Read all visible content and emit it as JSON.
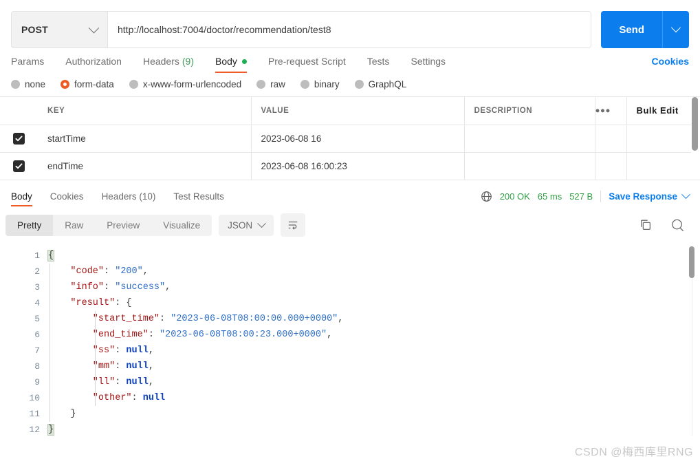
{
  "request": {
    "method": "POST",
    "url": "http://localhost:7004/doctor/recommendation/test8",
    "send_label": "Send",
    "tabs": [
      {
        "label": "Params",
        "active": false
      },
      {
        "label": "Authorization",
        "active": false
      },
      {
        "label": "Headers",
        "count": "(9)",
        "active": false
      },
      {
        "label": "Body",
        "active": true,
        "dot": true
      },
      {
        "label": "Pre-request Script",
        "active": false
      },
      {
        "label": "Tests",
        "active": false
      },
      {
        "label": "Settings",
        "active": false
      }
    ],
    "cookies_label": "Cookies",
    "body_types": [
      {
        "label": "none",
        "checked": false
      },
      {
        "label": "form-data",
        "checked": true
      },
      {
        "label": "x-www-form-urlencoded",
        "checked": false
      },
      {
        "label": "raw",
        "checked": false
      },
      {
        "label": "binary",
        "checked": false
      },
      {
        "label": "GraphQL",
        "checked": false
      }
    ],
    "table": {
      "headers": {
        "key": "KEY",
        "value": "VALUE",
        "description": "DESCRIPTION"
      },
      "dots_label": "●●●",
      "bulk_edit_label": "Bulk Edit",
      "rows": [
        {
          "checked": true,
          "key": "startTime",
          "value": "2023-06-08 16",
          "description": ""
        },
        {
          "checked": true,
          "key": "endTime",
          "value": "2023-06-08 16:00:23",
          "description": ""
        }
      ]
    }
  },
  "response": {
    "tabs": [
      {
        "label": "Body",
        "active": true
      },
      {
        "label": "Cookies",
        "active": false
      },
      {
        "label": "Headers (10)",
        "active": false
      },
      {
        "label": "Test Results",
        "active": false
      }
    ],
    "status": "200 OK",
    "time": "65 ms",
    "size": "527 B",
    "save_response_label": "Save Response",
    "view_modes": [
      {
        "label": "Pretty",
        "active": true
      },
      {
        "label": "Raw",
        "active": false
      },
      {
        "label": "Preview",
        "active": false
      },
      {
        "label": "Visualize",
        "active": false
      }
    ],
    "format": "JSON",
    "code_lines": [
      {
        "n": "1",
        "indent": 0,
        "tokens": [
          {
            "t": "{",
            "c": "p brace-hl"
          }
        ]
      },
      {
        "n": "2",
        "indent": 1,
        "tokens": [
          {
            "t": "    \"code\"",
            "c": "k"
          },
          {
            "t": ": ",
            "c": "p"
          },
          {
            "t": "\"200\"",
            "c": "s"
          },
          {
            "t": ",",
            "c": "p"
          }
        ]
      },
      {
        "n": "3",
        "indent": 1,
        "tokens": [
          {
            "t": "    \"info\"",
            "c": "k"
          },
          {
            "t": ": ",
            "c": "p"
          },
          {
            "t": "\"success\"",
            "c": "s"
          },
          {
            "t": ",",
            "c": "p"
          }
        ]
      },
      {
        "n": "4",
        "indent": 1,
        "tokens": [
          {
            "t": "    \"result\"",
            "c": "k"
          },
          {
            "t": ": ",
            "c": "p"
          },
          {
            "t": "{",
            "c": "p"
          }
        ]
      },
      {
        "n": "5",
        "indent": 2,
        "tokens": [
          {
            "t": "        \"start_time\"",
            "c": "k"
          },
          {
            "t": ": ",
            "c": "p"
          },
          {
            "t": "\"2023-06-08T08:00:00.000+0000\"",
            "c": "s"
          },
          {
            "t": ",",
            "c": "p"
          }
        ]
      },
      {
        "n": "6",
        "indent": 2,
        "tokens": [
          {
            "t": "        \"end_time\"",
            "c": "k"
          },
          {
            "t": ": ",
            "c": "p"
          },
          {
            "t": "\"2023-06-08T08:00:23.000+0000\"",
            "c": "s"
          },
          {
            "t": ",",
            "c": "p"
          }
        ]
      },
      {
        "n": "7",
        "indent": 2,
        "tokens": [
          {
            "t": "        \"ss\"",
            "c": "k"
          },
          {
            "t": ": ",
            "c": "p"
          },
          {
            "t": "null",
            "c": "nl"
          },
          {
            "t": ",",
            "c": "p"
          }
        ]
      },
      {
        "n": "8",
        "indent": 2,
        "tokens": [
          {
            "t": "        \"mm\"",
            "c": "k"
          },
          {
            "t": ": ",
            "c": "p"
          },
          {
            "t": "null",
            "c": "nl"
          },
          {
            "t": ",",
            "c": "p"
          }
        ]
      },
      {
        "n": "9",
        "indent": 2,
        "tokens": [
          {
            "t": "        \"ll\"",
            "c": "k"
          },
          {
            "t": ": ",
            "c": "p"
          },
          {
            "t": "null",
            "c": "nl"
          },
          {
            "t": ",",
            "c": "p"
          }
        ]
      },
      {
        "n": "10",
        "indent": 2,
        "tokens": [
          {
            "t": "        \"other\"",
            "c": "k"
          },
          {
            "t": ": ",
            "c": "p"
          },
          {
            "t": "null",
            "c": "nl"
          }
        ]
      },
      {
        "n": "11",
        "indent": 1,
        "tokens": [
          {
            "t": "    }",
            "c": "p"
          }
        ]
      },
      {
        "n": "12",
        "indent": 0,
        "tokens": [
          {
            "t": "}",
            "c": "p brace-hl"
          }
        ]
      }
    ]
  },
  "watermark": "CSDN @梅西库里RNG",
  "colors": {
    "accent_blue": "#0b7ded",
    "accent_orange": "#ef5b25",
    "status_green": "#2f9e44",
    "json_key": "#a31515",
    "json_string": "#2e6ec4",
    "json_null": "#0b40c0"
  }
}
